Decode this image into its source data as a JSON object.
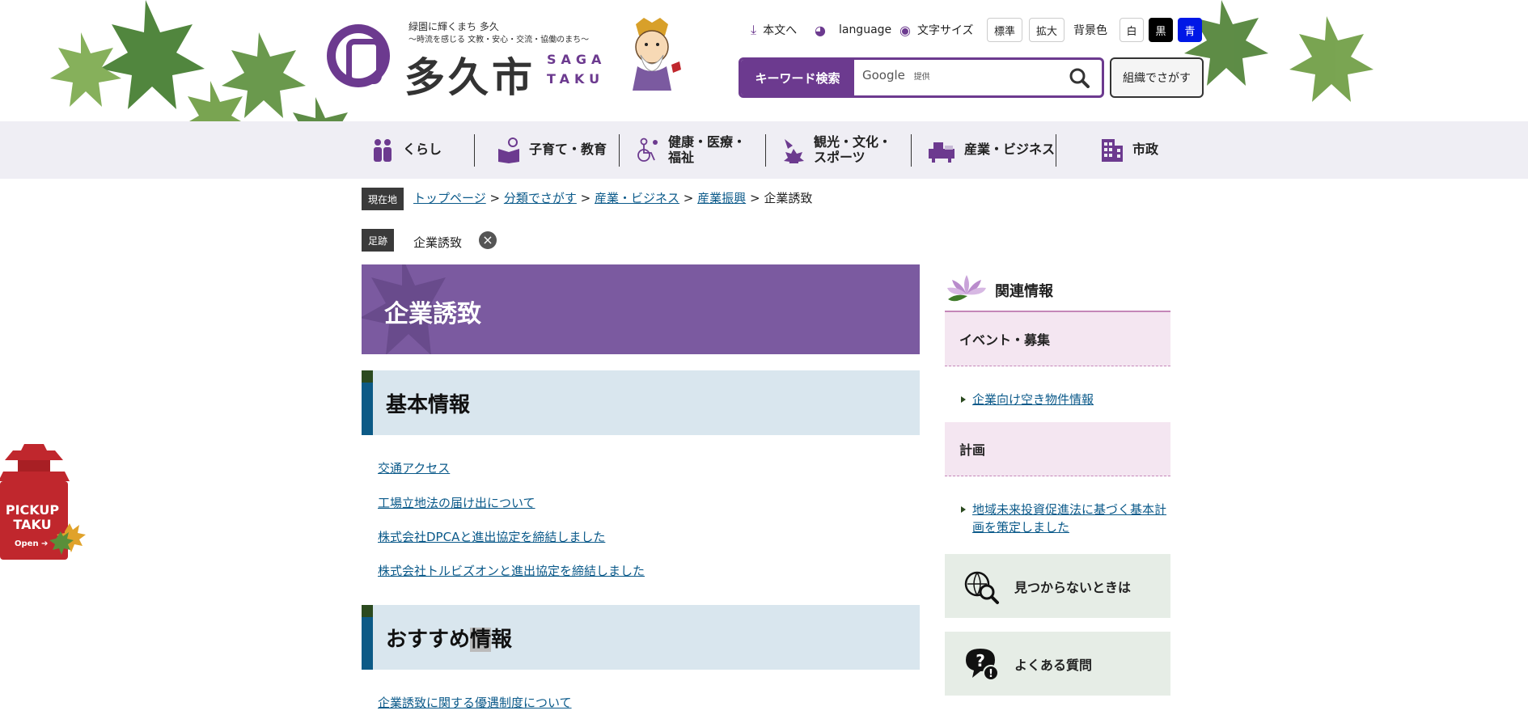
{
  "header": {
    "tagline1": "緑園に輝くまち 多久",
    "tagline2": "〜時流を感じる 文教・安心・交流・協働のまち〜",
    "city_name": "多久市",
    "saga": "SAGA",
    "taku": "TAKU"
  },
  "utility": {
    "skip_label": "本文へ",
    "language_label": "language",
    "font_size_label": "文字サイズ",
    "size_normal": "標準",
    "size_large": "拡大",
    "bg_color_label": "背景色",
    "bg_white": "白",
    "bg_black": "黒",
    "bg_blue": "青"
  },
  "search": {
    "label": "キーワード検索",
    "google": "Google",
    "provided": "提供",
    "org_button": "組織でさがす"
  },
  "nav": {
    "items": [
      {
        "label1": "くらし",
        "label2": ""
      },
      {
        "label1": "子育て・教育",
        "label2": ""
      },
      {
        "label1": "健康・医療・",
        "label2": "福祉"
      },
      {
        "label1": "観光・文化・",
        "label2": "スポーツ"
      },
      {
        "label1": "産業・ビジネス",
        "label2": ""
      },
      {
        "label1": "市政",
        "label2": ""
      }
    ]
  },
  "breadcrumb": {
    "current_tag": "現在地",
    "items": [
      "トップページ",
      "分類でさがす",
      "産業・ビジネス",
      "産業振興"
    ],
    "current": "企業誘致",
    "sep": ">"
  },
  "footprint": {
    "tag": "足跡",
    "item": "企業誘致"
  },
  "main": {
    "title": "企業誘致",
    "sections": [
      {
        "heading": "基本情報",
        "links": [
          "交通アクセス",
          "工場立地法の届け出について",
          "株式会社DPCAと進出協定を締結しました",
          "株式会社トルビズオンと進出協定を締結しました"
        ]
      },
      {
        "heading_a": "おすすめ",
        "heading_b": "情",
        "heading_c": "報",
        "links": [
          "企業誘致に関する優遇制度について"
        ]
      }
    ]
  },
  "side": {
    "title": "関連情報",
    "cat1": "イベント・募集",
    "cat1_link": "企業向け空き物件情報",
    "cat2": "計画",
    "cat2_link": "地域未来投資促進法に基づく基本計画を策定しました",
    "help1": "見つからないときは",
    "help2": "よくある質問"
  },
  "pickup": {
    "line1": "PICKUP",
    "line2": "TAKU",
    "open": "Open"
  },
  "colors": {
    "brand_purple": "#6c3a8f",
    "title_bg": "#7b5aa0",
    "section_bg": "#d9e6ee",
    "side_cat_bg": "#f4e6f1",
    "help_bg": "#e6ede6",
    "pickup_red": "#c0272d"
  }
}
